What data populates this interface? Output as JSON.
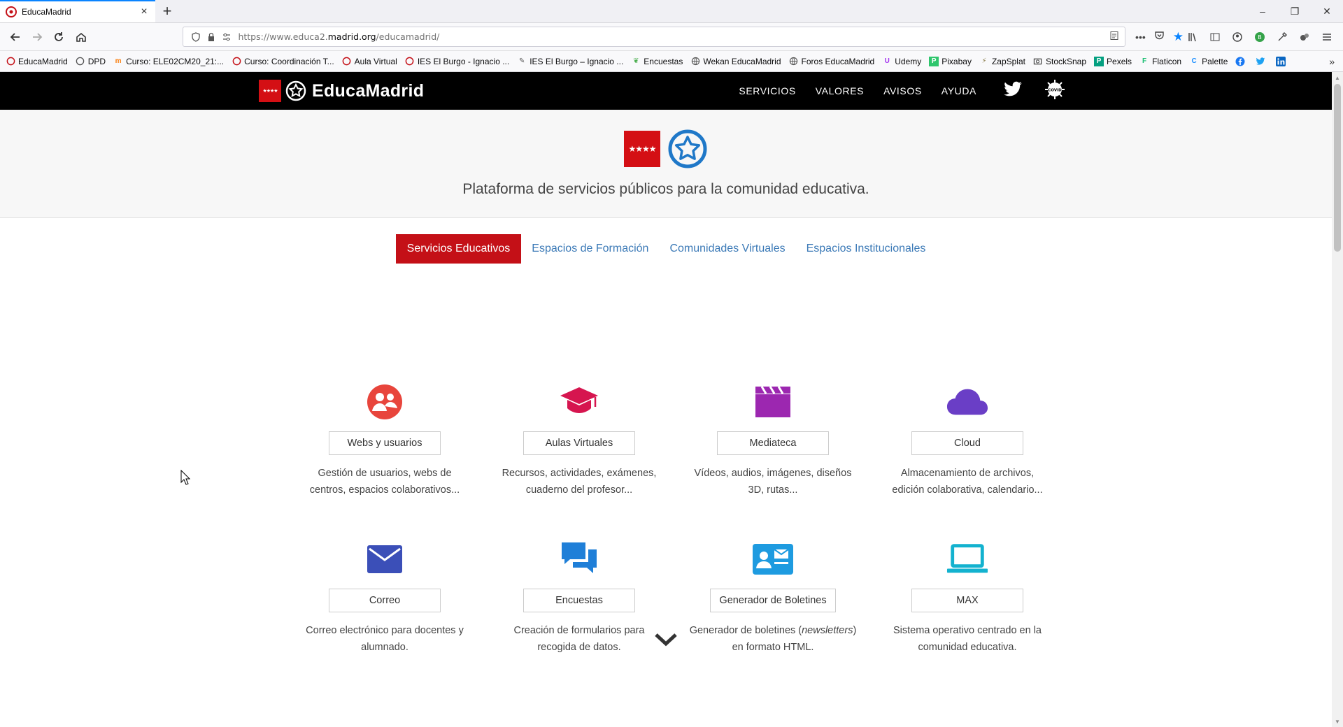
{
  "browser": {
    "tab_title": "EducaMadrid",
    "new_tab": "+",
    "url_prefix": "https://www.educa2.",
    "url_host": "madrid.org",
    "url_path": "/educamadrid/",
    "window_controls": [
      "–",
      "❐",
      "✕"
    ]
  },
  "bookmarks": [
    "EducaMadrid",
    "DPD",
    "Curso: ELE02CM20_21:...",
    "Curso: Coordinación T...",
    "Aula Virtual",
    "IES El Burgo - Ignacio ...",
    "IES El Burgo – Ignacio ...",
    "Encuestas",
    "Wekan EducaMadrid",
    "Foros EducaMadrid",
    "Udemy",
    "Pixabay",
    "ZapSplat",
    "StockSnap",
    "Pexels",
    "Flaticon",
    "Palette"
  ],
  "site": {
    "brand": "EducaMadrid",
    "nav": [
      "SERVICIOS",
      "VALORES",
      "AVISOS",
      "AYUDA"
    ],
    "covid_label": "COVID",
    "tagline": "Plataforma de servicios públicos para la comunidad educativa."
  },
  "tabs": [
    "Servicios Educativos",
    "Espacios de Formación",
    "Comunidades Virtuales",
    "Espacios Institucionales"
  ],
  "services": [
    {
      "label": "Webs y usuarios",
      "desc1": "Gestión de usuarios, webs de",
      "desc2": "centros, espacios colaborativos...",
      "color": "#e8453c",
      "icon": "users-icon"
    },
    {
      "label": "Aulas Virtuales",
      "desc1": "Recursos, actividades, exámenes,",
      "desc2": "cuaderno del profesor...",
      "color": "#d6154f",
      "icon": "graduation-cap-icon"
    },
    {
      "label": "Mediateca",
      "desc1": "Vídeos, audios, imágenes, diseños",
      "desc2": "3D, rutas...",
      "color": "#9c27b0",
      "icon": "clapperboard-icon"
    },
    {
      "label": "Cloud",
      "desc1": "Almacenamiento de archivos,",
      "desc2": "edición colaborativa, calendario...",
      "color": "#6a3ec6",
      "icon": "cloud-icon"
    },
    {
      "label": "Correo",
      "desc1": "Correo electrónico para docentes y",
      "desc2": "alumnado.",
      "color": "#3b4fb8",
      "icon": "envelope-icon"
    },
    {
      "label": "Encuestas",
      "desc1": "Creación de formularios para",
      "desc2": "recogida de datos.",
      "color": "#1f7fd8",
      "icon": "chat-bubbles-icon"
    },
    {
      "label": "Generador de Boletines",
      "desc1a": "Generador de boletines (",
      "desc1b": "newsletters",
      "desc1c": ")",
      "desc2": "en formato HTML.",
      "color": "#1e9be0",
      "icon": "id-card-icon"
    },
    {
      "label": "MAX",
      "desc1": "Sistema operativo centrado en la",
      "desc2": "comunidad educativa.",
      "color": "#13b2cf",
      "icon": "laptop-icon"
    }
  ]
}
